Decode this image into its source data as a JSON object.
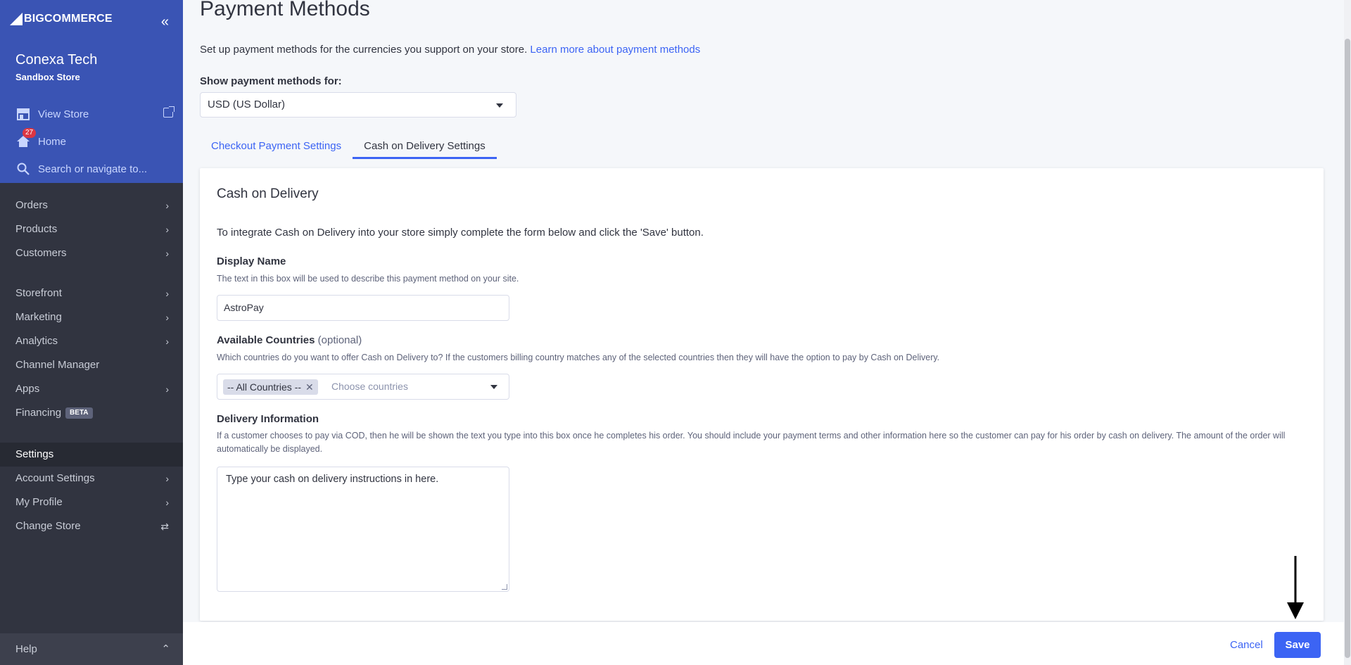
{
  "sidebar": {
    "brand": "COMMERCE",
    "brand_prefix": "BIG",
    "store_name": "Conexa Tech",
    "store_type": "Sandbox Store",
    "view_store": "View Store",
    "home": "Home",
    "home_badge": "27",
    "search_placeholder": "Search or navigate to...",
    "group1": [
      {
        "label": "Orders"
      },
      {
        "label": "Products"
      },
      {
        "label": "Customers"
      }
    ],
    "group2": [
      {
        "label": "Storefront"
      },
      {
        "label": "Marketing"
      },
      {
        "label": "Analytics"
      },
      {
        "label": "Channel Manager"
      },
      {
        "label": "Apps"
      },
      {
        "label": "Financing",
        "badge": "BETA"
      }
    ],
    "group3": [
      {
        "label": "Settings"
      },
      {
        "label": "Account Settings"
      },
      {
        "label": "My Profile"
      },
      {
        "label": "Change Store"
      }
    ],
    "help": "Help"
  },
  "header": {
    "title": "Payment Methods",
    "intro": "Set up payment methods for the currencies you support on your store.",
    "intro_link": "Learn more about payment methods",
    "show_label": "Show payment methods for:",
    "currency": "USD (US Dollar)"
  },
  "tabs": [
    {
      "label": "Checkout Payment Settings"
    },
    {
      "label": "Cash on Delivery Settings"
    }
  ],
  "card": {
    "title": "Cash on Delivery",
    "description": "To integrate Cash on Delivery into your store simply complete the form below and click the 'Save' button.",
    "display_name": {
      "label": "Display Name",
      "help": "The text in this box will be used to describe this payment method on your site.",
      "value": "AstroPay"
    },
    "countries": {
      "label": "Available Countries",
      "optional": "(optional)",
      "help": "Which countries do you want to offer Cash on Delivery to? If the customers billing country matches any of the selected countries then they will have the option to pay by Cash on Delivery.",
      "chip": "-- All Countries --",
      "placeholder": "Choose countries"
    },
    "delivery": {
      "label": "Delivery Information",
      "help": "If a customer chooses to pay via COD, then he will be shown the text you type into this box once he completes his order. You should include your payment terms and other information here so the customer can pay for his order by cash on delivery. The amount of the order will automatically be displayed.",
      "value": "Type your cash on delivery instructions in here."
    }
  },
  "footer": {
    "cancel": "Cancel",
    "save": "Save"
  },
  "colors": {
    "accent": "#3c64f4",
    "sidebar_top": "#3a54b4",
    "sidebar_bg": "#313440"
  }
}
